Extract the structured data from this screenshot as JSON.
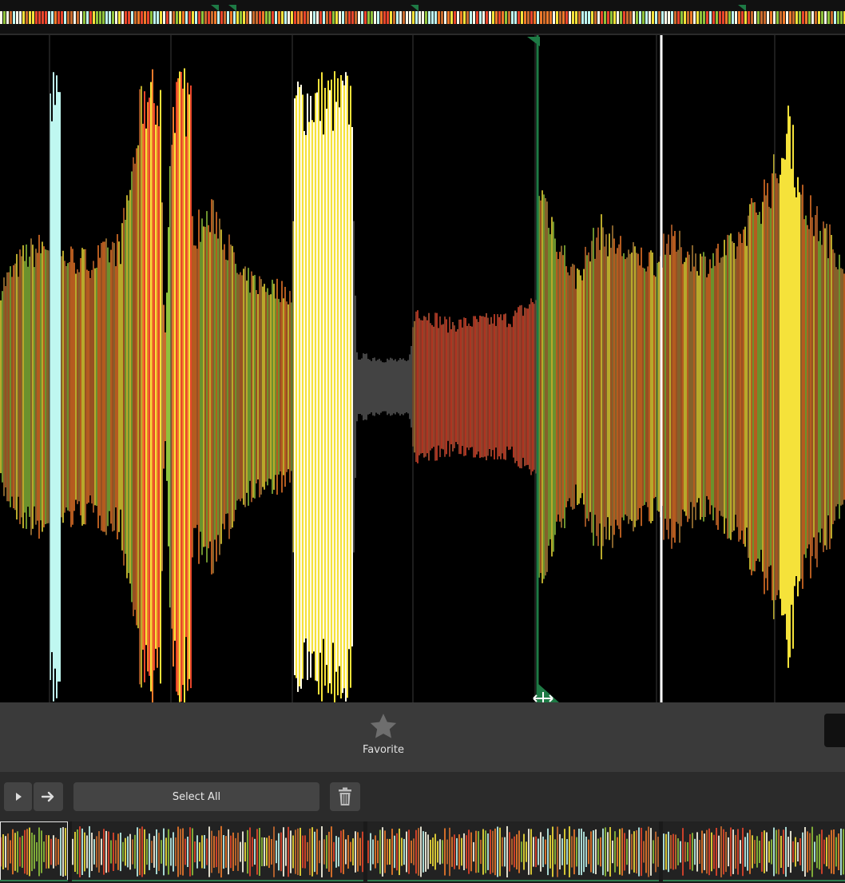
{
  "toolbar": {
    "select_all_label": "Select All",
    "play_icon": "play-icon",
    "next_icon": "arrow-right-icon",
    "delete_icon": "trash-icon"
  },
  "favorite": {
    "label": "Favorite",
    "icon": "star-icon"
  },
  "playhead": {
    "color": "#ffffff"
  },
  "cue_marker": {
    "color": "#1e7a45"
  },
  "palette": {
    "red": "#e8452c",
    "orange": "#f07a2a",
    "yellow": "#f5e23a",
    "green": "#8fc23c",
    "cyan": "#bff7f0",
    "white": "#fffbe8",
    "grey": "#5a5a5a"
  },
  "clips": [
    {
      "id": "clip-1",
      "selected": true
    },
    {
      "id": "clip-2",
      "selected": false
    },
    {
      "id": "clip-3",
      "selected": false
    },
    {
      "id": "clip-4",
      "selected": false
    }
  ]
}
